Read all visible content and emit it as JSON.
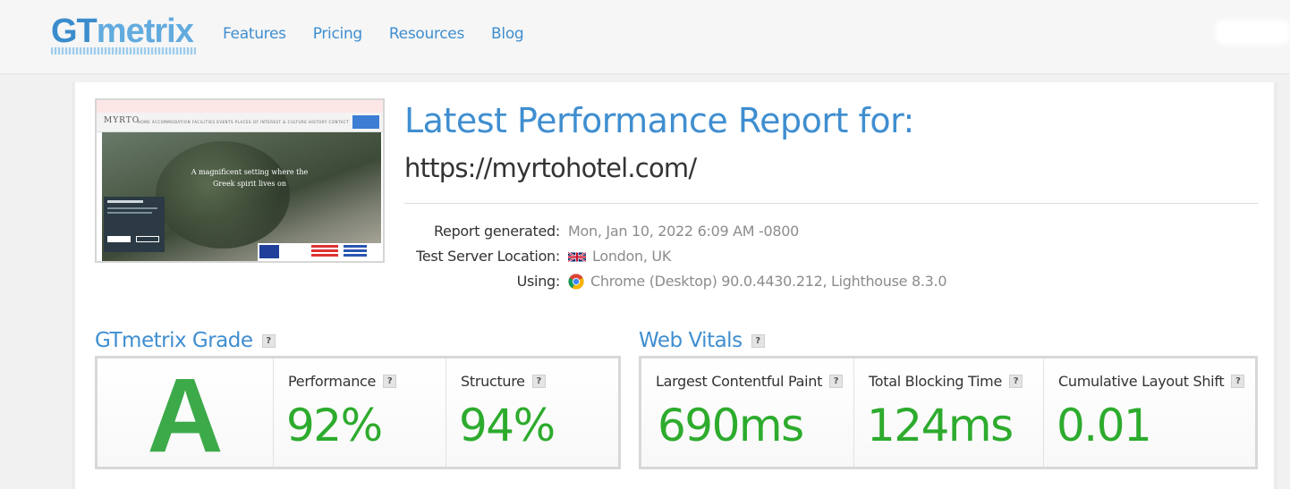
{
  "header": {
    "logo_gt": "GT",
    "logo_metrix": "metrix",
    "nav": [
      "Features",
      "Pricing",
      "Resources",
      "Blog"
    ]
  },
  "thumbnail": {
    "brand": "MYRTO",
    "menu": "HOME ACCOMMODATION FACILITIES EVENTS PLACES OF INTEREST & CULTURE HISTORY CONTACT",
    "tagline": "A magnificent setting where the Greek spirit lives on"
  },
  "report": {
    "title": "Latest Performance Report for:",
    "url": "https://myrtohotel.com/",
    "meta": [
      {
        "key": "Report generated:",
        "value": "Mon, Jan 10, 2022 6:09 AM -0800",
        "icon": ""
      },
      {
        "key": "Test Server Location:",
        "value": "London, UK",
        "icon": "uk-flag-icon"
      },
      {
        "key": "Using:",
        "value": "Chrome (Desktop) 90.0.4430.212, Lighthouse 8.3.0",
        "icon": "chrome-icon"
      }
    ]
  },
  "grade": {
    "title": "GTmetrix Grade",
    "help": "?",
    "letter": "A",
    "performance_label": "Performance",
    "performance_value": "92%",
    "structure_label": "Structure",
    "structure_value": "94%"
  },
  "vitals": {
    "title": "Web Vitals",
    "help": "?",
    "lcp_label": "Largest Contentful Paint",
    "lcp_value": "690ms",
    "tbt_label": "Total Blocking Time",
    "tbt_value": "124ms",
    "cls_label": "Cumulative Layout Shift",
    "cls_value": "0.01"
  },
  "colors": {
    "brand_blue": "#3f8ed0",
    "good_green": "#2dab2d",
    "grade_green": "#3daa4a"
  }
}
